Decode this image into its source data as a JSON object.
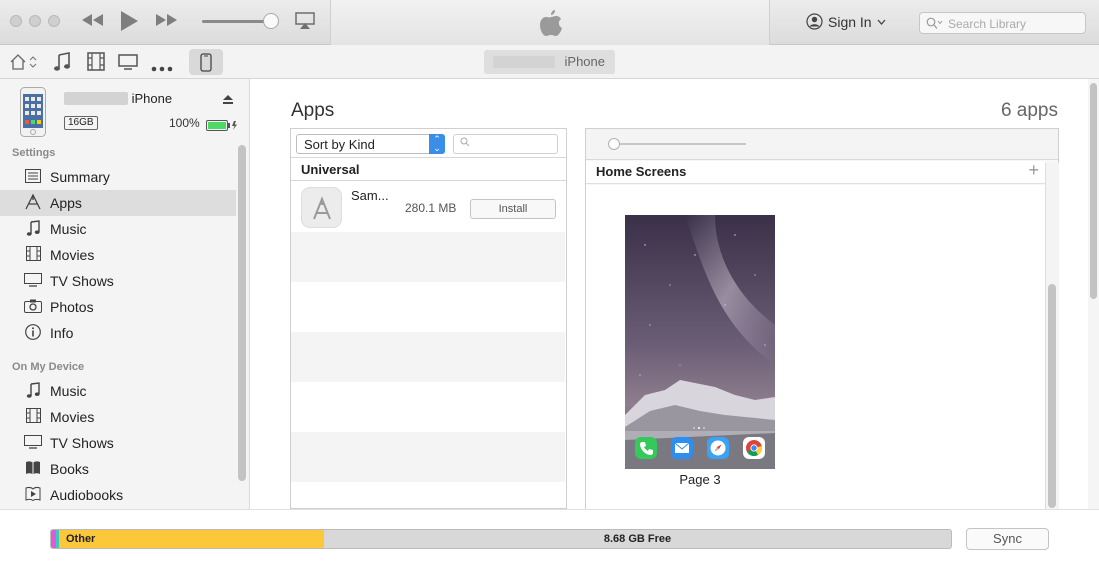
{
  "titlebar": {
    "sign_in_label": "Sign In",
    "search_placeholder": "Search Library"
  },
  "device_tab": {
    "name_suffix": "iPhone"
  },
  "device": {
    "name_suffix": "iPhone",
    "capacity": "16GB",
    "battery_percent": "100%",
    "battery_level": 1.0
  },
  "sidebar": {
    "settings_heading": "Settings",
    "settings_items": [
      {
        "label": "Summary",
        "icon": "summary-icon"
      },
      {
        "label": "Apps",
        "icon": "apps-icon",
        "selected": true
      },
      {
        "label": "Music",
        "icon": "music-icon"
      },
      {
        "label": "Movies",
        "icon": "movies-icon"
      },
      {
        "label": "TV Shows",
        "icon": "tv-icon"
      },
      {
        "label": "Photos",
        "icon": "camera-icon"
      },
      {
        "label": "Info",
        "icon": "info-icon"
      }
    ],
    "on_device_heading": "On My Device",
    "on_device_items": [
      {
        "label": "Music",
        "icon": "music-icon"
      },
      {
        "label": "Movies",
        "icon": "movies-icon"
      },
      {
        "label": "TV Shows",
        "icon": "tv-icon"
      },
      {
        "label": "Books",
        "icon": "books-icon"
      },
      {
        "label": "Audiobooks",
        "icon": "audiobooks-icon"
      }
    ]
  },
  "apps": {
    "title": "Apps",
    "count": "6 apps",
    "sort_value": "Sort by Kind",
    "group_header": "Universal",
    "list": [
      {
        "name": "Sam...",
        "size": "280.1 MB",
        "action": "Install"
      }
    ]
  },
  "home_screens": {
    "title": "Home Screens",
    "page_label": "Page 3",
    "dock_apps": [
      {
        "name": "phone",
        "color": "#35c85a"
      },
      {
        "name": "mail",
        "color": "#2b8ef0"
      },
      {
        "name": "safari",
        "color": "#3aa3f5"
      },
      {
        "name": "chrome",
        "color": "#ffffff"
      }
    ]
  },
  "capacity_bar": {
    "other_label": "Other",
    "free_label": "8.68 GB Free",
    "colors": {
      "other": "#fcc83a",
      "apps": "#e05ad6",
      "free": "#d8d8d8"
    }
  },
  "sync_label": "Sync"
}
